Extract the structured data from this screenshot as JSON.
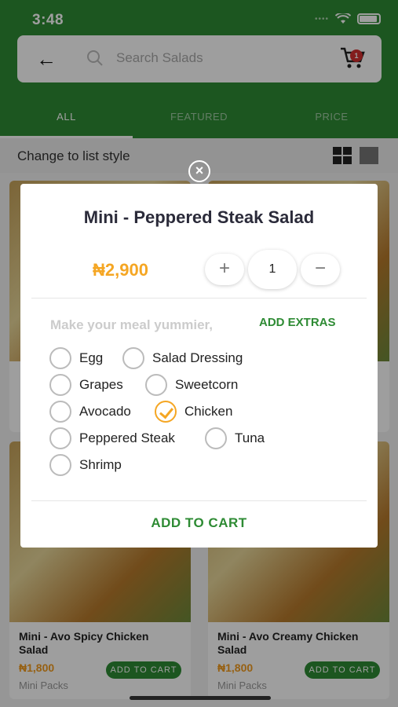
{
  "status_bar": {
    "time": "3:48"
  },
  "search": {
    "placeholder": "Search Salads",
    "cart_count": "1"
  },
  "tabs": [
    {
      "label": "ALL"
    },
    {
      "label": "FEATURED"
    },
    {
      "label": "PRICE"
    }
  ],
  "list_toggle": {
    "label": "Change to list style"
  },
  "cards": [
    {
      "name": "Mini - Avo Spicy Chicken Salad",
      "price": "₦1,800",
      "button": "ADD TO CART",
      "pack": "Mini Packs"
    },
    {
      "name": "Mini - Avo Creamy Chicken Salad",
      "price": "₦1,800",
      "button": "ADD TO CART",
      "pack": "Mini Packs"
    }
  ],
  "modal": {
    "close": "×",
    "title": "Mini - Peppered Steak Salad",
    "price": "₦2,900",
    "quantity": "1",
    "plus": "+",
    "minus": "−",
    "prompt": "Make your meal yummier,",
    "extras_label": "ADD EXTRAS",
    "options": [
      {
        "label": "Egg",
        "checked": false
      },
      {
        "label": "Salad Dressing",
        "checked": false
      },
      {
        "label": "Grapes",
        "checked": false
      },
      {
        "label": "Sweetcorn",
        "checked": false
      },
      {
        "label": "Avocado",
        "checked": false
      },
      {
        "label": "Chicken",
        "checked": true
      },
      {
        "label": "Peppered Steak",
        "checked": false
      },
      {
        "label": "Tuna",
        "checked": false
      },
      {
        "label": "Shrimp",
        "checked": false
      }
    ],
    "add_to_cart": "ADD TO CART"
  },
  "colors": {
    "brand_green": "#2e8b34",
    "price_orange": "#f5a623"
  }
}
